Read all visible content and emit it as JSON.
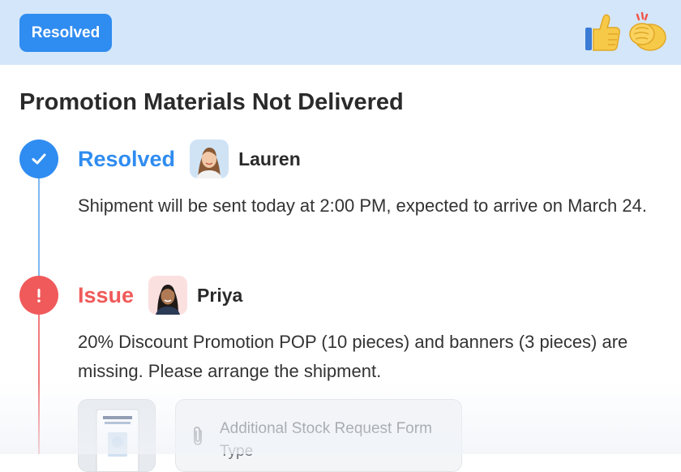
{
  "header": {
    "status_badge": "Resolved",
    "reactions": [
      {
        "icon": "thumbs-up-icon"
      },
      {
        "icon": "clapping-hands-icon"
      }
    ]
  },
  "ticket": {
    "title": "Promotion Materials Not Delivered"
  },
  "timeline": [
    {
      "status": "Resolved",
      "status_color": "#2f8cf0",
      "user": "Lauren",
      "message": "Shipment will be sent today at 2:00 PM, expected to arrive on March 24."
    },
    {
      "status": "Issue",
      "status_color": "#f05a5a",
      "user": "Priya",
      "message": "20% Discount Promotion POP (10 pieces) and banners (3 pieces) are missing. Please arrange the shipment.",
      "attachments": [
        {
          "type": "image-thumbnail"
        },
        {
          "type": "file",
          "name": "Additional Stock Request Form Type"
        }
      ]
    }
  ]
}
